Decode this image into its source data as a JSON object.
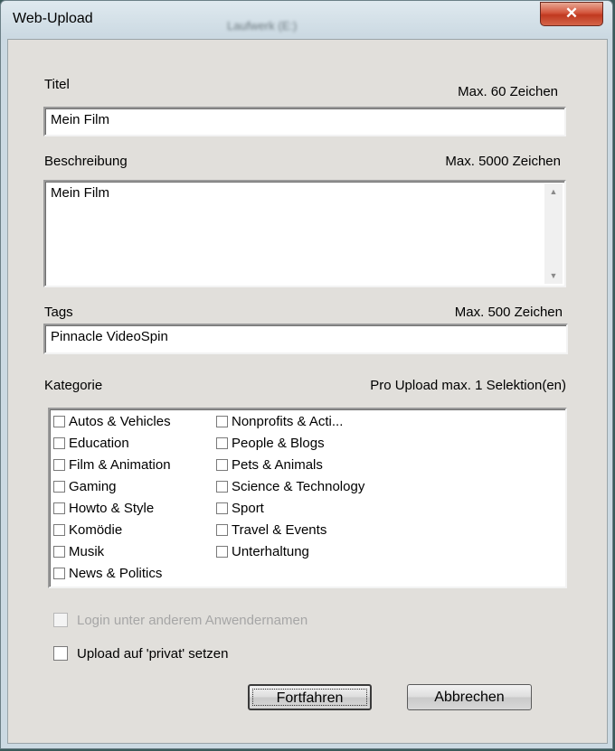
{
  "window": {
    "title": "Web-Upload",
    "background_title": "Laufwerk (E:)",
    "close_label": "✕"
  },
  "titel": {
    "label": "Titel",
    "max": "Max. 60 Zeichen",
    "value": "Mein Film"
  },
  "beschreibung": {
    "label": "Beschreibung",
    "max": "Max. 5000 Zeichen",
    "value": "Mein Film"
  },
  "tags": {
    "label": "Tags",
    "max": "Max. 500 Zeichen",
    "value": "Pinnacle VideoSpin"
  },
  "kategorie": {
    "label": "Kategorie",
    "max": "Pro Upload max. 1 Selektion(en)",
    "col1": [
      "Autos & Vehicles",
      "Education",
      "Film & Animation",
      "Gaming",
      "Howto & Style",
      "Komödie",
      "Musik",
      "News & Politics"
    ],
    "col2": [
      "Nonprofits & Acti...",
      "People & Blogs",
      "Pets & Animals",
      "Science & Technology",
      "Sport",
      "Travel & Events",
      "Unterhaltung"
    ]
  },
  "options": {
    "login_label": "Login unter anderem Anwendernamen",
    "private_label": "Upload auf 'privat' setzen"
  },
  "buttons": {
    "continue": "Fortfahren",
    "cancel": "Abbrechen"
  }
}
